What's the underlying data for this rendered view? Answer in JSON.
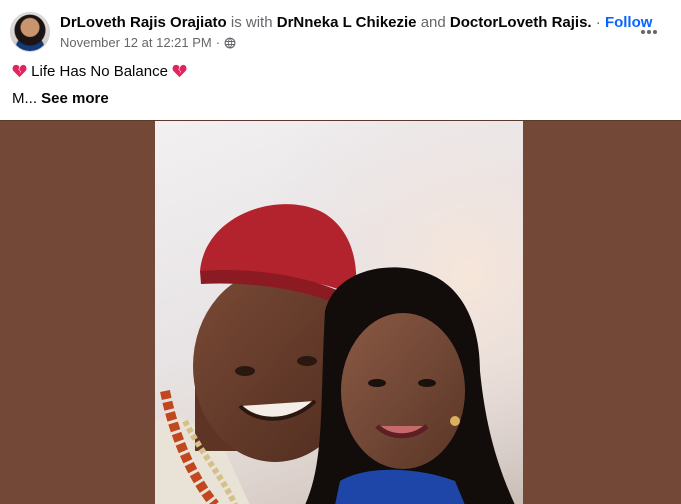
{
  "post": {
    "author": "DrLoveth Rajis Orajiato",
    "is_with": "is with",
    "tagged_1": "DrNneka L Chikezie",
    "and": "and",
    "tagged_2": "DoctorLoveth Rajis.",
    "separator": "·",
    "follow_label": "Follow",
    "timestamp": "November 12 at 12:21 PM",
    "meta_dot": "·",
    "privacy_icon": "globe-icon",
    "text_line1": "Life Has No Balance",
    "emoji": "broken-heart-icon",
    "text_line2_prefix": "M...",
    "see_more": "See more"
  },
  "colors": {
    "link_blue": "#0866ff",
    "muted": "#65676b",
    "photo_backdrop": "#744836"
  }
}
